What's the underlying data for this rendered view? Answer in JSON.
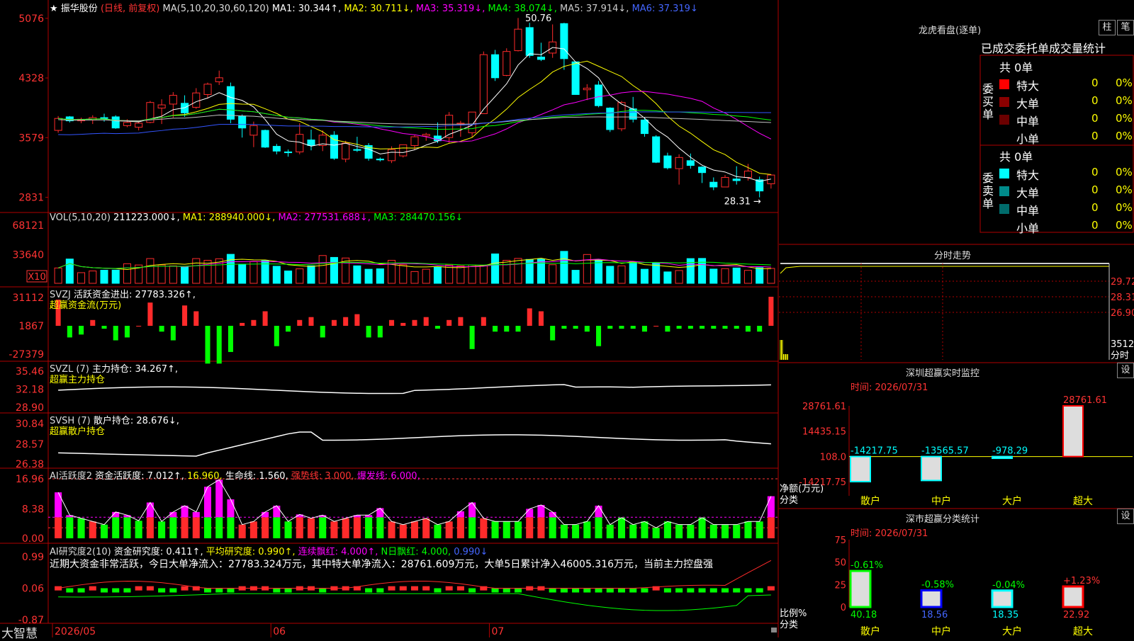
{
  "app": {
    "brand": "大智慧",
    "lock_icon": "lock-icon"
  },
  "main_chart": {
    "header": {
      "star": "★",
      "name": "振华股份",
      "mode": "(日线, 前复权)",
      "ma_label": "MA(5,10,20,30,60,120)",
      "ma1": "MA1: 30.344↑,",
      "ma2": "MA2: 30.711↓,",
      "ma3": "MA3: 35.319↓,",
      "ma4": "MA4: 38.074↓,",
      "ma5": "MA5: 37.914↓,",
      "ma6": "MA6: 37.319↓"
    },
    "yticks": [
      "5076",
      "4328",
      "3579",
      "2831"
    ],
    "high_label": "50.76",
    "low_label": "28.31",
    "xticks": [
      "2026/05",
      "06",
      "07"
    ]
  },
  "vol": {
    "header": {
      "label": "VOL(5,10,20)",
      "val": "211223.000↓,",
      "ma1": "MA1: 288940.000↓,",
      "ma2": "MA2: 277531.688↓,",
      "ma3": "MA3: 284470.156↓"
    },
    "yticks": [
      "68121",
      "33640"
    ],
    "unit": "X10"
  },
  "svzj": {
    "header": {
      "label": "SVZJ",
      "val": "活跃资金进出: 27783.326↑,"
    },
    "sub": "超赢资金流(万元)",
    "yticks": [
      "31112",
      "1867",
      "-27379"
    ]
  },
  "svzl": {
    "header": {
      "label": "SVZL (7)",
      "val": "主力持仓: 34.267↑,"
    },
    "sub": "超赢主力持仓",
    "yticks": [
      "35.46",
      "32.18",
      "28.90"
    ]
  },
  "svsh": {
    "header": {
      "label": "SVSH (7)",
      "val": "散户持仓: 28.676↓,"
    },
    "sub": "超赢散户持仓",
    "yticks": [
      "30.84",
      "28.57",
      "26.38"
    ]
  },
  "ai2": {
    "header": {
      "label": "AI活跃度2",
      "a": "资金活跃度: 7.012↑,",
      "b": "16.960,",
      "c": "生命线: 1.560,",
      "d": "强势线: 3.000,",
      "e": "爆发线: 6.000,"
    },
    "yticks": [
      "16.96",
      "8.38",
      "0.00"
    ]
  },
  "ai3": {
    "header": {
      "label": "AI研究度2(10)",
      "a": "资金研究度: 0.411↑,",
      "b": "平均研究度: 0.990↑,",
      "c": "连续飘红: 4.000↑,",
      "d": "N日飘红: 4.000,",
      "e": "0.990↓"
    },
    "note": "近期大资金非常活跃，今日大单净流入：27783.324万元，其中特大单净流入：28761.609万元，大单5日累计净入46005.316万元，当前主力控盘强",
    "yticks": [
      "0.99",
      "0.06",
      "-0.87"
    ]
  },
  "lhb": {
    "title": "龙虎看盘(逐单)",
    "btn1": "柱",
    "btn2": "笔",
    "tab": "已成交委托单成交量统计",
    "buy": {
      "side": "委买单",
      "total": "共 0单",
      "rows": [
        {
          "name": "特大",
          "n": "0",
          "p": "0%",
          "color": "#ff0000"
        },
        {
          "name": "大单",
          "n": "0",
          "p": "0%",
          "color": "#8b0000"
        },
        {
          "name": "中单",
          "n": "0",
          "p": "0%",
          "color": "#6b0000"
        },
        {
          "name": "小单",
          "n": "0",
          "p": "0%",
          "color": "#000000"
        }
      ]
    },
    "sell": {
      "side": "委卖单",
      "total": "共 0单",
      "rows": [
        {
          "name": "特大",
          "n": "0",
          "p": "0%",
          "color": "#00ffff"
        },
        {
          "name": "大单",
          "n": "0",
          "p": "0%",
          "color": "#008b8b"
        },
        {
          "name": "中单",
          "n": "0",
          "p": "0%",
          "color": "#006b6b"
        },
        {
          "name": "小单",
          "n": "0",
          "p": "0%",
          "color": "#000000"
        }
      ]
    }
  },
  "fenshi": {
    "title": "分时走势",
    "yticks": [
      "29.72",
      "28.31",
      "26.90"
    ],
    "vol_label": "35120",
    "unit": "分时"
  },
  "monitor": {
    "title": "深圳超赢实时监控",
    "btn": "设",
    "time": "时间: 2026/07/31",
    "yticks": [
      "28761.61",
      "14435.15",
      "108.0",
      "-14217.75"
    ],
    "ylabel": "净额(万元)",
    "xlabel": "分类",
    "chart_data": {
      "type": "bar",
      "categories": [
        "散户",
        "中户",
        "大户",
        "超大"
      ],
      "values": [
        -14217.75,
        -13565.57,
        -978.29,
        28761.61
      ],
      "value_labels": [
        "-14217.75",
        "-13565.57",
        "-978.29",
        "28761.61"
      ],
      "ylim": [
        -14217.75,
        28761.61
      ]
    }
  },
  "stats": {
    "title": "深市超赢分类统计",
    "btn": "设",
    "time": "时间: 2026/07/31",
    "yticks": [
      "75",
      "50",
      "25",
      "0"
    ],
    "ylabel": "比例%",
    "xlabel": "分类",
    "chart_data": {
      "type": "bar",
      "categories": [
        "散户",
        "中户",
        "大户",
        "超大"
      ],
      "values": [
        40.18,
        18.56,
        18.35,
        22.92
      ],
      "changes": [
        "-0.61%",
        "-0.58%",
        "-0.04%",
        "+1.23%"
      ],
      "ylim": [
        0,
        75
      ]
    }
  },
  "colors": {
    "up": "#ff2b2b",
    "down": "#00ffff",
    "green": "#00ff00",
    "magenta": "#ff00ff",
    "yellow": "#ffff00",
    "axis": "#b00000"
  },
  "chart_data": {
    "type": "candlestick",
    "dates_x": [
      "2026/05",
      "06",
      "07"
    ],
    "ohlc": [
      [
        36.7,
        38.5,
        36.4,
        38.2
      ],
      [
        38.4,
        38.5,
        37.7,
        37.9
      ],
      [
        37.9,
        38.3,
        37.6,
        38.1
      ],
      [
        38.0,
        38.6,
        37.5,
        38.3
      ],
      [
        38.3,
        38.8,
        37.8,
        38.2
      ],
      [
        38.4,
        38.6,
        36.9,
        37.0
      ],
      [
        37.3,
        38.1,
        37.1,
        37.7
      ],
      [
        37.1,
        37.8,
        36.7,
        37.6
      ],
      [
        37.7,
        40.4,
        37.6,
        40.2
      ],
      [
        39.5,
        40.6,
        37.5,
        39.9
      ],
      [
        40.0,
        41.5,
        38.3,
        41.1
      ],
      [
        40.1,
        41.1,
        38.4,
        38.9
      ],
      [
        39.6,
        42.0,
        39.4,
        41.4
      ],
      [
        41.2,
        42.7,
        40.7,
        42.5
      ],
      [
        42.8,
        44.2,
        42.4,
        43.3
      ],
      [
        42.2,
        42.7,
        37.6,
        38.1
      ],
      [
        38.5,
        38.7,
        35.8,
        37.0
      ],
      [
        36.1,
        37.8,
        34.6,
        37.3
      ],
      [
        36.7,
        36.8,
        34.5,
        34.6
      ],
      [
        34.7,
        35.0,
        33.7,
        34.1
      ],
      [
        34.0,
        34.3,
        33.4,
        33.9
      ],
      [
        34.0,
        37.6,
        33.7,
        36.2
      ],
      [
        35.5,
        36.8,
        34.2,
        34.8
      ],
      [
        34.8,
        36.7,
        34.1,
        36.1
      ],
      [
        36.1,
        36.6,
        33.0,
        33.2
      ],
      [
        33.1,
        35.4,
        32.7,
        35.1
      ],
      [
        34.3,
        35.9,
        34.0,
        34.2
      ],
      [
        34.8,
        35.1,
        32.9,
        33.2
      ],
      [
        33.1,
        33.3,
        32.8,
        33.0
      ],
      [
        32.9,
        34.7,
        32.6,
        34.3
      ],
      [
        33.5,
        34.9,
        33.3,
        34.9
      ],
      [
        34.8,
        36.1,
        34.3,
        35.9
      ],
      [
        36.0,
        36.4,
        35.4,
        36.2
      ],
      [
        36.0,
        37.7,
        35.1,
        35.4
      ],
      [
        35.8,
        39.0,
        35.1,
        38.6
      ],
      [
        37.5,
        37.9,
        35.9,
        37.6
      ],
      [
        36.4,
        38.9,
        35.8,
        39.0
      ],
      [
        38.8,
        46.6,
        38.8,
        46.2
      ],
      [
        46.2,
        46.8,
        42.9,
        43.3
      ],
      [
        43.6,
        47.0,
        43.5,
        46.6
      ],
      [
        46.7,
        50.8,
        46.6,
        49.4
      ],
      [
        49.6,
        50.2,
        45.8,
        46.1
      ],
      [
        45.9,
        47.7,
        45.4,
        45.6
      ],
      [
        46.4,
        50.0,
        45.8,
        47.8
      ],
      [
        50.1,
        50.2,
        44.3,
        45.7
      ],
      [
        45.3,
        45.3,
        41.2,
        41.2
      ],
      [
        41.8,
        42.5,
        40.5,
        42.0
      ],
      [
        42.4,
        42.9,
        39.6,
        39.8
      ],
      [
        39.5,
        39.6,
        36.5,
        36.8
      ],
      [
        36.9,
        40.4,
        36.6,
        40.2
      ],
      [
        39.4,
        40.9,
        37.7,
        38.1
      ],
      [
        38.0,
        38.3,
        35.9,
        36.3
      ],
      [
        35.9,
        36.1,
        32.6,
        32.7
      ],
      [
        33.5,
        33.9,
        31.8,
        32.0
      ],
      [
        31.9,
        33.7,
        29.9,
        33.3
      ],
      [
        32.9,
        33.8,
        31.9,
        32.3
      ],
      [
        32.1,
        32.2,
        30.1,
        31.4
      ],
      [
        30.2,
        30.8,
        29.2,
        29.6
      ],
      [
        29.6,
        31.1,
        29.6,
        30.8
      ],
      [
        30.6,
        32.2,
        29.9,
        30.4
      ],
      [
        30.8,
        32.5,
        30.4,
        31.6
      ],
      [
        30.5,
        30.9,
        28.3,
        29.1
      ],
      [
        30.0,
        31.2,
        29.4,
        31.1
      ]
    ],
    "ma_series": [
      "MA1",
      "MA2",
      "MA3",
      "MA4",
      "MA5",
      "MA6"
    ],
    "vol": [
      18000,
      28500,
      12500,
      14500,
      15400,
      15500,
      23000,
      21500,
      29000,
      21500,
      20500,
      19300,
      29000,
      27000,
      28800,
      34000,
      22500,
      25500,
      26500,
      20000,
      14500,
      17000,
      20600,
      32600,
      30400,
      29700,
      20500,
      16500,
      17000,
      27000,
      21800,
      13800,
      16500,
      19400,
      21500,
      20500,
      21500,
      21000,
      34500,
      27000,
      29200,
      28000,
      28500,
      21800,
      37500,
      15300,
      33800,
      27400,
      20000,
      20500,
      25000,
      16500,
      23700,
      13400,
      15000,
      29000,
      29200,
      16700,
      17200,
      18000,
      15200,
      18400,
      17500,
      23600,
      13000,
      12700
    ],
    "vol_ylim": [
      0,
      68121
    ],
    "svzj": [
      0.9,
      -0.4,
      -0.3,
      0.2,
      -0.1,
      -0.5,
      -0.4,
      0.0,
      0.8,
      -0.2,
      -0.5,
      0.7,
      0.5,
      -1.3,
      -1.3,
      -0.9,
      0.1,
      0.2,
      0.5,
      -0.7,
      -0.2,
      0.2,
      0.3,
      -0.4,
      0.2,
      0.3,
      0.4,
      -0.4,
      -0.4,
      0.2,
      0.1,
      0.2,
      0.3,
      -0.1,
      0.2,
      0.3,
      -0.8,
      0.3,
      -0.2,
      -0.2,
      -0.2,
      0.6,
      0.5,
      -0.5,
      -0.1,
      -0.1,
      -0.2,
      -0.7,
      -0.1,
      -0.1,
      -0.1,
      -0.2,
      0.0,
      -0.2,
      -0.1,
      -0.1,
      -0.1,
      -0.1,
      -0.1,
      -0.1,
      -0.2,
      -0.2,
      1.0
    ],
    "svzj_ylim": [
      -27379,
      31112
    ],
    "svzl_ylim": [
      28.9,
      35.46
    ],
    "svsh_ylim": [
      26.38,
      30.84
    ],
    "ai2_ylim": [
      0,
      16.96
    ],
    "ai3_ylim": [
      -0.87,
      0.99
    ]
  }
}
